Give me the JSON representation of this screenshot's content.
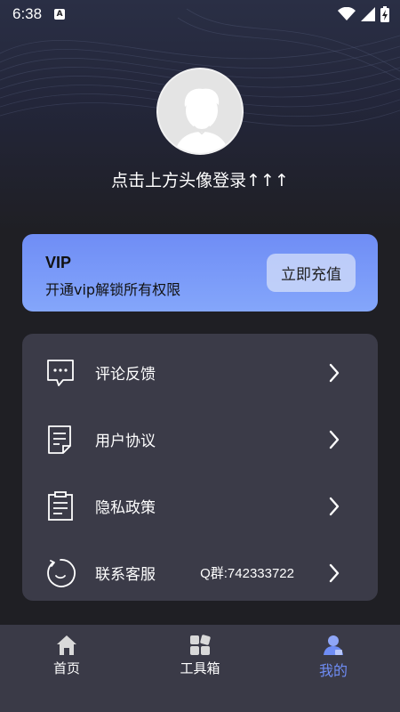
{
  "status_bar": {
    "time": "6:38",
    "notification_icon": "A"
  },
  "profile": {
    "login_prompt": "点击上方头像登录↑↑↑"
  },
  "vip": {
    "title": "VIP",
    "subtitle": "开通vip解锁所有权限",
    "button_label": "立即充值"
  },
  "menu": {
    "items": [
      {
        "label": "评论反馈",
        "icon": "chat-bubble-icon",
        "extra": ""
      },
      {
        "label": "用户协议",
        "icon": "document-icon",
        "extra": ""
      },
      {
        "label": "隐私政策",
        "icon": "clipboard-icon",
        "extra": ""
      },
      {
        "label": "联系客服",
        "icon": "customer-service-icon",
        "extra": "Q群:742333722"
      }
    ]
  },
  "bottom_nav": {
    "items": [
      {
        "label": "首页",
        "icon": "home-icon",
        "active": false
      },
      {
        "label": "工具箱",
        "icon": "toolbox-icon",
        "active": false
      },
      {
        "label": "我的",
        "icon": "profile-icon",
        "active": true
      }
    ]
  },
  "colors": {
    "background": "#1f1f24",
    "card": "#3b3b48",
    "vip_gradient_start": "#6f8df5",
    "vip_gradient_end": "#84a6fb",
    "active_tab": "#6f8df5"
  }
}
